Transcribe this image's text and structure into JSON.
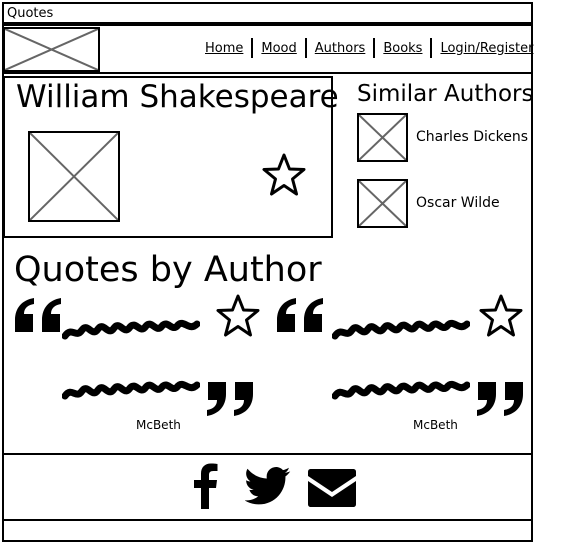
{
  "window": {
    "title": "Quotes"
  },
  "header": {
    "logo_icon": "image-placeholder-icon",
    "nav": [
      {
        "label": "Home"
      },
      {
        "label": "Mood"
      },
      {
        "label": "Authors"
      },
      {
        "label": "Books"
      },
      {
        "label": "Login/Register"
      }
    ]
  },
  "author": {
    "name": "William Shakespeare",
    "image_icon": "image-placeholder-icon",
    "favorite_icon": "star-outline-icon"
  },
  "similar": {
    "title": "Similar Authors",
    "items": [
      {
        "name": "Charles Dickens",
        "icon": "image-placeholder-icon"
      },
      {
        "name": "Oscar Wilde",
        "icon": "image-placeholder-icon"
      }
    ]
  },
  "quotes": {
    "title": "Quotes by Author",
    "items": [
      {
        "source": "McBeth",
        "favorite_icon": "star-outline-icon",
        "open_icon": "open-quote-icon",
        "close_icon": "close-quote-icon"
      },
      {
        "source": "McBeth",
        "favorite_icon": "star-outline-icon",
        "open_icon": "open-quote-icon",
        "close_icon": "close-quote-icon"
      }
    ]
  },
  "footer": {
    "social_icons": [
      "facebook-icon",
      "twitter-icon",
      "envelope-icon"
    ]
  }
}
